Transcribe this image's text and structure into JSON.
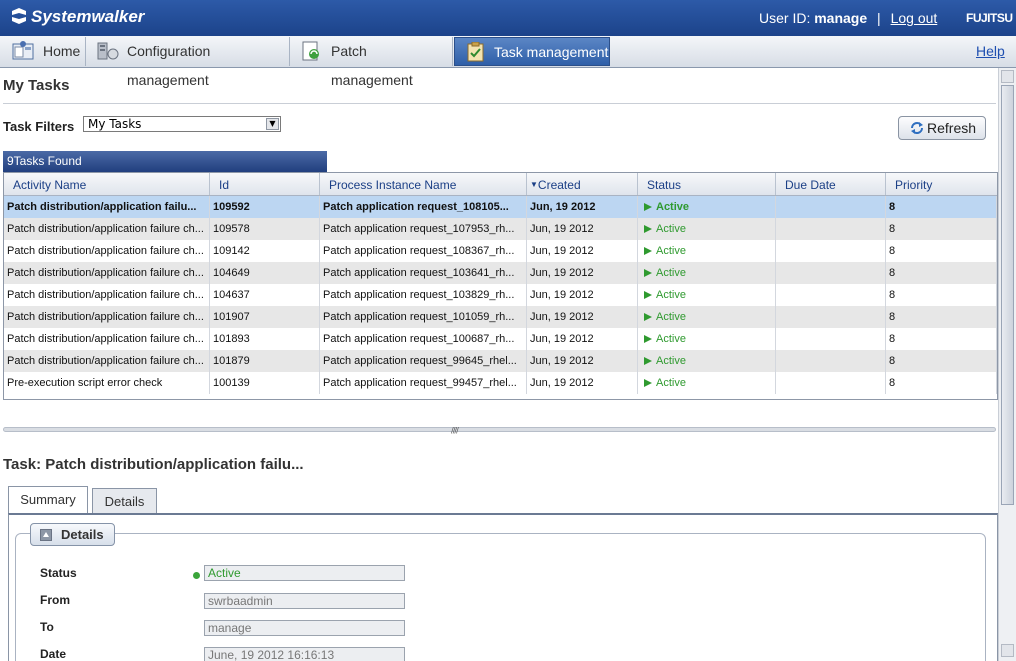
{
  "header": {
    "brand": "Systemwalker",
    "user_id_label": "User ID:",
    "user_id": "manage",
    "separator": "|",
    "logout": "Log out",
    "vendor_logo": "FUJITSU"
  },
  "nav": {
    "tabs": [
      {
        "label": "Home",
        "icon": "home-icon",
        "active": false
      },
      {
        "label": "Configuration management",
        "icon": "server-config-icon",
        "active": false
      },
      {
        "label": "Patch management",
        "icon": "patch-icon",
        "active": false
      },
      {
        "label": "Task management",
        "icon": "clipboard-check-icon",
        "active": true
      }
    ],
    "help": "Help"
  },
  "page": {
    "title": "My Tasks",
    "filter_label": "Task Filters",
    "filter_value": "My Tasks",
    "refresh_label": "Refresh",
    "found_label": "9Tasks Found"
  },
  "grid": {
    "columns": [
      "Activity Name",
      "Id",
      "Process Instance Name",
      "Created",
      "Status",
      "Due Date",
      "Priority"
    ],
    "sort_column": "Created",
    "rows": [
      {
        "activity": "Patch distribution/application failu...",
        "id": "109592",
        "process": "Patch application request_108105...",
        "created": "Jun, 19 2012",
        "status": "Active",
        "due": "",
        "priority": "8"
      },
      {
        "activity": "Patch distribution/application failure ch...",
        "id": "109578",
        "process": "Patch application request_107953_rh...",
        "created": "Jun, 19 2012",
        "status": "Active",
        "due": "",
        "priority": "8"
      },
      {
        "activity": "Patch distribution/application failure ch...",
        "id": "109142",
        "process": "Patch application request_108367_rh...",
        "created": "Jun, 19 2012",
        "status": "Active",
        "due": "",
        "priority": "8"
      },
      {
        "activity": "Patch distribution/application failure ch...",
        "id": "104649",
        "process": "Patch application request_103641_rh...",
        "created": "Jun, 19 2012",
        "status": "Active",
        "due": "",
        "priority": "8"
      },
      {
        "activity": "Patch distribution/application failure ch...",
        "id": "104637",
        "process": "Patch application request_103829_rh...",
        "created": "Jun, 19 2012",
        "status": "Active",
        "due": "",
        "priority": "8"
      },
      {
        "activity": "Patch distribution/application failure ch...",
        "id": "101907",
        "process": "Patch application request_101059_rh...",
        "created": "Jun, 19 2012",
        "status": "Active",
        "due": "",
        "priority": "8"
      },
      {
        "activity": "Patch distribution/application failure ch...",
        "id": "101893",
        "process": "Patch application request_100687_rh...",
        "created": "Jun, 19 2012",
        "status": "Active",
        "due": "",
        "priority": "8"
      },
      {
        "activity": "Patch distribution/application failure ch...",
        "id": "101879",
        "process": "Patch application request_99645_rhel...",
        "created": "Jun, 19 2012",
        "status": "Active",
        "due": "",
        "priority": "8"
      },
      {
        "activity": "Pre-execution script error check",
        "id": "100139",
        "process": "Patch application request_99457_rhel...",
        "created": "Jun, 19 2012",
        "status": "Active",
        "due": "",
        "priority": "8"
      }
    ],
    "selected_row": 0
  },
  "task": {
    "title": "Task: Patch distribution/application failu...",
    "tabs": [
      "Summary",
      "Details"
    ],
    "details_legend": "Details",
    "fields": [
      {
        "label": "Status",
        "value": "Active"
      },
      {
        "label": "From",
        "value": "swrbaadmin"
      },
      {
        "label": "To",
        "value": "manage"
      },
      {
        "label": "Date",
        "value": "June, 19 2012 16:16:13"
      }
    ]
  },
  "colors": {
    "header_blue": "#1c438a",
    "active_green": "#2f9a2f",
    "selected_row": "#bcd6f2"
  }
}
